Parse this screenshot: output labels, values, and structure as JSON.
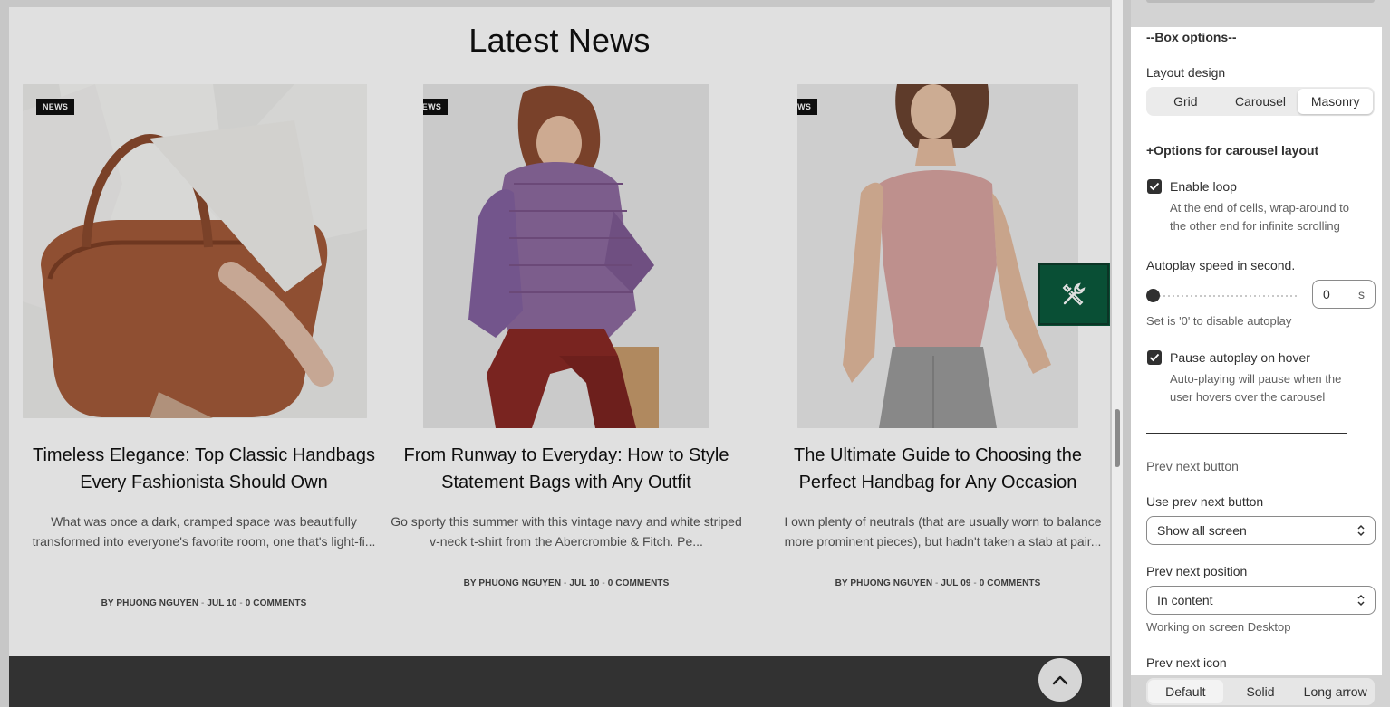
{
  "preview": {
    "section_title": "Latest News",
    "cards": [
      {
        "badge": "NEWS",
        "title_line1": "Timeless Elegance: Top Classic Handbags",
        "title_line2": "Every Fashionista Should Own",
        "excerpt": "What was once a dark, cramped space was beautifully transformed into everyone's favorite room, one that's light-fi...",
        "author": "BY PHUONG NGUYEN",
        "date": "JUL 10",
        "comments": "0 COMMENTS"
      },
      {
        "badge": "NEWS",
        "title_line1": "From Runway to Everyday: How to Style",
        "title_line2": "Statement Bags with Any Outfit",
        "excerpt": "Go sporty this summer with this vintage navy and white striped v-neck t-shirt from the Abercrombie & Fitch. Pe...",
        "author": "BY PHUONG NGUYEN",
        "date": "JUL 10",
        "comments": "0 COMMENTS"
      },
      {
        "badge": "NEWS",
        "title_line1": "The Ultimate Guide to Choosing the",
        "title_line2": "Perfect Handbag for Any Occasion",
        "excerpt": "I own plenty of neutrals (that are usually worn to balance more prominent pieces), but hadn't taken a stab at pair...",
        "author": "BY PHUONG NGUYEN",
        "date": "JUL 09",
        "comments": "0 COMMENTS"
      }
    ],
    "separator": " - ",
    "tool_button_icon": "tools-icon",
    "scroll_top_icon": "chevron-up-icon"
  },
  "panel": {
    "box_options_heading": "--Box options--",
    "layout_design_label": "Layout design",
    "layout_options": [
      "Grid",
      "Carousel",
      "Masonry"
    ],
    "layout_selected": "Masonry",
    "carousel_heading": "+Options for carousel layout",
    "enable_loop_label": "Enable loop",
    "enable_loop_checked": true,
    "enable_loop_help_1": "At the end of cells, wrap-around to",
    "enable_loop_help_2": "the other end for infinite scrolling",
    "autoplay_label": "Autoplay speed in second.",
    "autoplay_value": "0",
    "autoplay_unit": "s",
    "autoplay_help": "Set is '0' to disable autoplay",
    "pause_label": "Pause autoplay on hover",
    "pause_checked": true,
    "pause_help_1": "Auto-playing will pause when the",
    "pause_help_2": "user hovers over the carousel",
    "prev_next_heading": "Prev next button",
    "use_prev_next_label": "Use prev next button",
    "use_prev_next_value": "Show all screen",
    "prev_next_position_label": "Prev next position",
    "prev_next_position_value": "In content",
    "working_on": "Working on screen Desktop",
    "prev_next_icon_label": "Prev next icon",
    "icon_options": [
      "Default",
      "Solid",
      "Long arrow"
    ],
    "icon_selected": "Default"
  },
  "colors": {
    "tool_button": "#0b5a3d",
    "footer": "#3a3a3a",
    "checkbox": "#303030"
  }
}
